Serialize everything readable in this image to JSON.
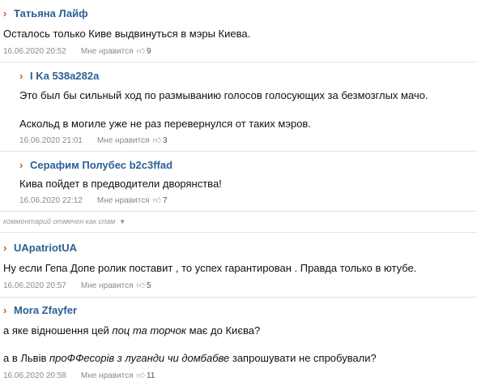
{
  "comments": [
    {
      "author": "Татьяна Лайф",
      "text": "Осталось только Киве выдвинуться в мэры Киева.",
      "date": "16.06.2020 20:52",
      "like_label": "Мне нравится",
      "likes": "9"
    },
    {
      "author": "I Ka 538a282a",
      "line1": "Это был бы сильный ход по размыванию голосов голосующих за безмозглых мачо.",
      "line2": "Аскольд в могиле уже не раз перевернулся от таких мэров.",
      "date": "16.06.2020 21:01",
      "like_label": "Мне нравится",
      "likes": "3"
    },
    {
      "author": "Серафим Полубес b2c3ffad",
      "text": "Кива пойдет в предводители дворянства!",
      "date": "16.06.2020 22:12",
      "like_label": "Мне нравится",
      "likes": "7"
    },
    {
      "author": "UApatriotUA",
      "text": "Ну если Гепа Допе ролик поставит , то успех гарантирован . Правда только в ютубе.",
      "date": "16.06.2020 20:57",
      "like_label": "Мне нравится",
      "likes": "5"
    },
    {
      "author": "Mora Zfayfer",
      "line1": {
        "a": "а яке відношення цей ",
        "i": "поц та торчок",
        "b": " має до Києва?"
      },
      "line2": {
        "a": "а в Львів ",
        "i": "проФФесорів з луганди чи домбабве",
        "b": " запрошувати не спробували?"
      },
      "date": "16.06.2020 20:58",
      "like_label": "Мне нравится",
      "likes": "11"
    }
  ],
  "spam_notice": "комментарий отмечен как спам",
  "icons": {
    "chevron": "chevron-right-icon",
    "thumb": "thumbs-up-icon",
    "spam_toggle": "triangle-down-icon"
  }
}
